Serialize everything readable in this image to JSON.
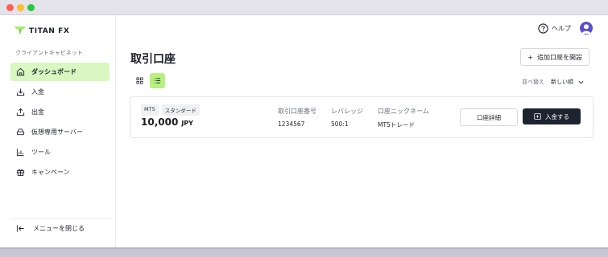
{
  "colors": {
    "brand_green": "#a6ee6b",
    "active_nav_bg": "#d9f7c1",
    "toggle_active_bg": "#b7f07f",
    "primary_button": "#1e2330",
    "avatar": "#5b4fc9"
  },
  "window_controls": [
    "close",
    "minimize",
    "zoom"
  ],
  "brand": {
    "logo_text": "TITAN FX"
  },
  "sidebar": {
    "section_label": "クライアントキャビネット",
    "items": [
      {
        "label": "ダッシュボード",
        "icon": "home-icon",
        "active": true
      },
      {
        "label": "入金",
        "icon": "deposit-icon"
      },
      {
        "label": "出金",
        "icon": "withdraw-icon"
      },
      {
        "label": "仮想専用サーバー",
        "icon": "server-icon"
      },
      {
        "label": "ツール",
        "icon": "chart-icon"
      },
      {
        "label": "キャンペーン",
        "icon": "gift-icon"
      }
    ],
    "close_menu_label": "メニューを閉じる"
  },
  "header": {
    "help_label": "ヘルプ"
  },
  "main": {
    "title": "取引口座",
    "add_account_label": "追加口座を開設",
    "sort_label": "並べ替え",
    "sort_value": "新しい順",
    "account": {
      "platform": "MT5",
      "type": "スタンダード",
      "balance": "10,000",
      "currency": "JPY",
      "fields": [
        {
          "label": "取引口座番号",
          "value": "1234567"
        },
        {
          "label": "レバレッジ",
          "value": "500:1"
        },
        {
          "label": "口座ニックネーム",
          "value": "MT5トレード"
        }
      ],
      "details_label": "口座詳細",
      "deposit_label": "入金する"
    }
  }
}
